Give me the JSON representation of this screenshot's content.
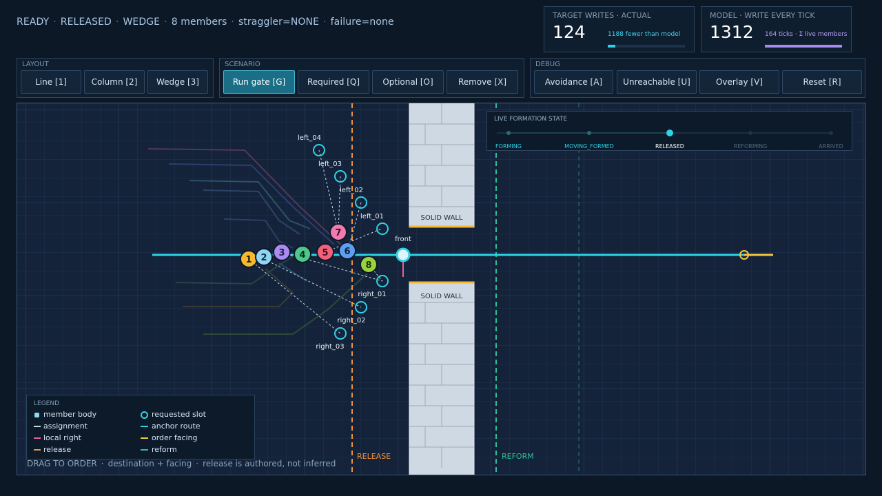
{
  "status": {
    "state": "READY",
    "mode": "RELEASED",
    "layout": "WEDGE",
    "members": "8 members",
    "straggler": "straggler=NONE",
    "failure": "failure=none"
  },
  "metrics": [
    {
      "label": "TARGET WRITES · ACTUAL",
      "value": "124",
      "sub": "1188 fewer than model",
      "fill": 0.095,
      "color": "#2ed3e6"
    },
    {
      "label": "MODEL · WRITE EVERY TICK",
      "value": "1312",
      "sub": "164 ticks · Σ live members",
      "fill": 1.0,
      "color": "#a88bf0"
    }
  ],
  "panels": {
    "layout": {
      "title": "LAYOUT",
      "buttons": [
        "Line [1]",
        "Column [2]",
        "Wedge [3]"
      ]
    },
    "scenario": {
      "title": "SCENARIO",
      "buttons": [
        "Run gate [G]",
        "Required [Q]",
        "Optional [O]",
        "Remove [X]"
      ],
      "active": "Run gate [G]"
    },
    "debug": {
      "title": "DEBUG",
      "buttons": [
        "Avoidance [A]",
        "Unreachable [U]",
        "Overlay [V]",
        "Reset [R]"
      ]
    }
  },
  "formation_state": {
    "title": "LIVE FORMATION STATE",
    "states": [
      "FORMING",
      "MOVING_FORMED",
      "RELEASED",
      "REFORMING",
      "ARRIVED"
    ],
    "current": "RELEASED"
  },
  "scene": {
    "walls": [
      "SOLID WALL",
      "SOLID WALL"
    ],
    "release_label": "RELEASE",
    "reform_label": "REFORM",
    "front_label": "front",
    "members": [
      "1",
      "2",
      "3",
      "4",
      "5",
      "6",
      "7",
      "8"
    ],
    "slots": [
      "left_04",
      "left_03",
      "left_02",
      "left_01",
      "right_01",
      "right_02",
      "right_03"
    ],
    "colors": {
      "m1": "#f5b82e",
      "m2": "#8fd6f5",
      "m3": "#a98bf2",
      "m4": "#4cc88a",
      "m5": "#f2607c",
      "m6": "#5d9ff2",
      "m7": "#f07bb0",
      "m8": "#9ad23c",
      "anchor": "#2ed3e6",
      "release": "#f0923a",
      "reform": "#2fbf9a",
      "order": "#f5c842",
      "right": "#e8609a"
    }
  },
  "legend": {
    "title": "LEGEND",
    "items": [
      "member body",
      "requested slot",
      "assignment",
      "anchor route",
      "local right",
      "order facing",
      "release",
      "reform"
    ]
  },
  "footer": {
    "a": "DRAG TO ORDER",
    "b": "destination + facing",
    "c": "release is authored, not inferred"
  }
}
